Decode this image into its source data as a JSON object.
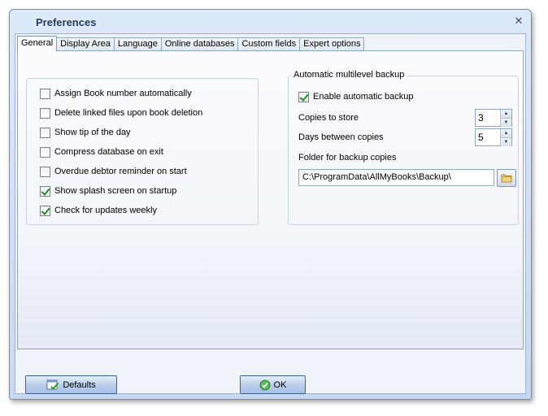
{
  "window": {
    "title": "Preferences",
    "close_glyph": "✕"
  },
  "tabs": [
    {
      "label": "General",
      "active": true
    },
    {
      "label": "Display Area",
      "active": false
    },
    {
      "label": "Language",
      "active": false
    },
    {
      "label": "Online databases",
      "active": false
    },
    {
      "label": "Custom fields",
      "active": false
    },
    {
      "label": "Expert options",
      "active": false
    }
  ],
  "general": {
    "options": [
      {
        "label": "Assign Book number automatically",
        "checked": false
      },
      {
        "label": "Delete linked files upon book deletion",
        "checked": false
      },
      {
        "label": "Show tip of the day",
        "checked": false
      },
      {
        "label": "Compress database on exit",
        "checked": false
      },
      {
        "label": "Overdue debtor reminder on start",
        "checked": false
      },
      {
        "label": "Show splash screen on startup",
        "checked": true
      },
      {
        "label": "Check for updates weekly",
        "checked": true
      }
    ]
  },
  "backup": {
    "legend": "Automatic multilevel backup",
    "enable_label": "Enable automatic backup",
    "enable_checked": true,
    "copies_label": "Copies to store",
    "copies_value": "3",
    "days_label": "Days between copies",
    "days_value": "5",
    "folder_label": "Folder for backup copies",
    "folder_value": "C:\\ProgramData\\AllMyBooks\\Backup\\"
  },
  "buttons": {
    "defaults_label": "Defaults",
    "ok_label": "OK"
  },
  "icons": {
    "spin_up": "▲",
    "spin_down": "▼",
    "browse": "folder-icon",
    "defaults": "defaults-icon",
    "ok": "ok-check-icon"
  }
}
